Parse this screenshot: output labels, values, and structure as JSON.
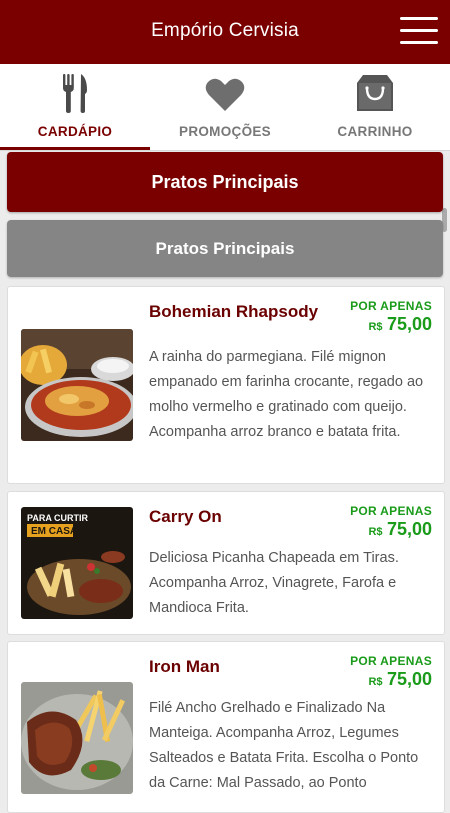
{
  "app": {
    "title": "Empório Cervisia"
  },
  "tabs": [
    {
      "label": "CARDÁPIO",
      "icon": "fork-knife-icon",
      "active": true
    },
    {
      "label": "PROMOÇÕES",
      "icon": "heart-icon",
      "active": false
    },
    {
      "label": "CARRINHO",
      "icon": "shopping-bag-icon",
      "active": false
    }
  ],
  "categories": {
    "selected_label": "Pratos Principais",
    "section_label": "Pratos Principais"
  },
  "products": [
    {
      "name": "Bohemian Rhapsody",
      "price_label": "POR APENAS",
      "currency": "R$",
      "price": "75,00",
      "description": "A rainha do parmegiana. Filé mignon empanado em farinha crocante, regado ao molho vermelho e gratinado com queijo. Acompanha arroz branco e batata frita."
    },
    {
      "name": "Carry On",
      "price_label": "POR APENAS",
      "currency": "R$",
      "price": "75,00",
      "description": "Deliciosa Picanha Chapeada em Tiras. Acompanha Arroz, Vinagrete, Farofa e Mandioca Frita.",
      "image_text": {
        "line1": "PARA CURTIR",
        "line2": "EM CASA"
      }
    },
    {
      "name": "Iron Man",
      "price_label": "POR APENAS",
      "currency": "R$",
      "price": "75,00",
      "description": "Filé Ancho Grelhado e Finalizado Na Manteiga. Acompanha Arroz, Legumes Salteados e Batata Frita. Escolha o Ponto da Carne: Mal Passado, ao Ponto"
    }
  ],
  "colors": {
    "brand": "#7a0000",
    "secondary_button": "#858585",
    "price_green": "#1a9b1a",
    "product_name": "#6b0000"
  }
}
